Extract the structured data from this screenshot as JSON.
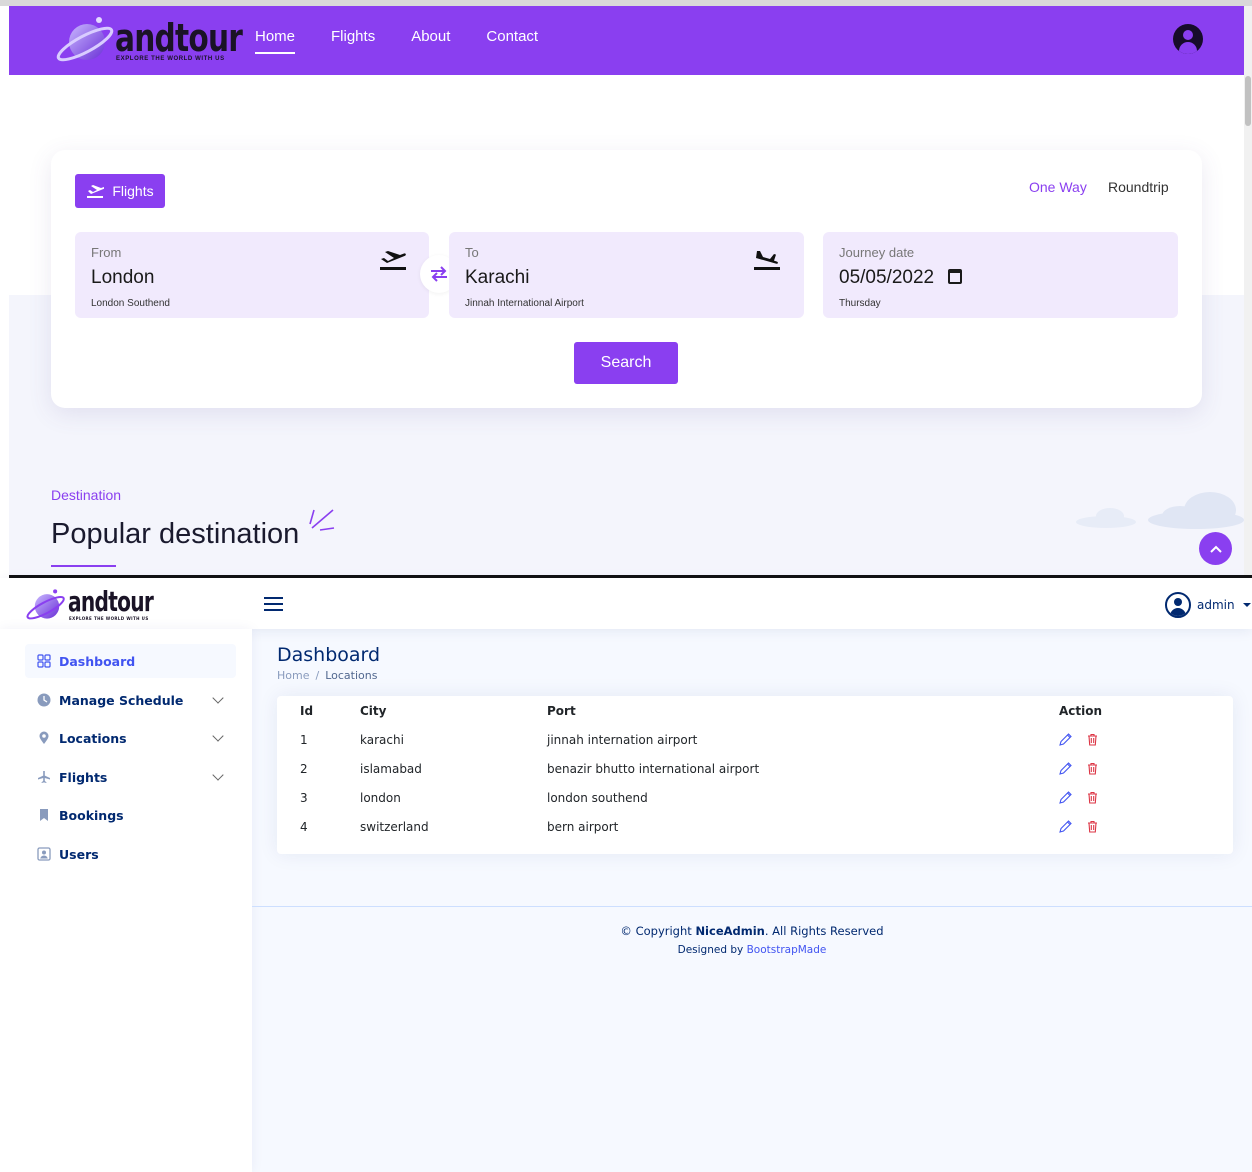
{
  "site": {
    "logo_word": "andtour",
    "logo_tagline": "EXPLORE THE WORLD WITH US",
    "nav": [
      {
        "label": "Home"
      },
      {
        "label": "Flights"
      },
      {
        "label": "About"
      },
      {
        "label": "Contact"
      }
    ],
    "search": {
      "tab_label": "Flights",
      "trip_one_way": "One Way",
      "trip_roundtrip": "Roundtrip",
      "from": {
        "label": "From",
        "value": "London",
        "sub": "London Southend"
      },
      "to": {
        "label": "To",
        "value": "Karachi",
        "sub": "Jinnah International Airport"
      },
      "date": {
        "label": "Journey date",
        "value": "05/05/2022",
        "sub": "Thursday"
      },
      "button": "Search"
    },
    "destination": {
      "label": "Destination",
      "title": "Popular destination"
    }
  },
  "admin": {
    "logo_word": "andtour",
    "logo_tagline": "EXPLORE THE WORLD WITH US",
    "user_name": "admin",
    "sidebar": [
      {
        "label": "Dashboard",
        "icon": "grid-icon",
        "active": true
      },
      {
        "label": "Manage Schedule",
        "icon": "clock-icon"
      },
      {
        "label": "Locations",
        "icon": "map-pin-icon"
      },
      {
        "label": "Flights",
        "icon": "plane-icon"
      },
      {
        "label": "Bookings",
        "icon": "bookmark-icon"
      },
      {
        "label": "Users",
        "icon": "person-badge-icon"
      }
    ],
    "page_title": "Dashboard",
    "breadcrumb": [
      "Home",
      "/",
      "Locations"
    ],
    "table": {
      "headers": [
        "Id",
        "City",
        "Port",
        "Action"
      ],
      "rows": [
        {
          "id": "1",
          "city": "karachi",
          "port": "jinnah internation airport"
        },
        {
          "id": "2",
          "city": "islamabad",
          "port": "benazir bhutto international airport"
        },
        {
          "id": "3",
          "city": "london",
          "port": "london southend"
        },
        {
          "id": "4",
          "city": "switzerland",
          "port": "bern airport"
        }
      ]
    },
    "footer": {
      "copyright_prefix": "© Copyright ",
      "copyright_brand": "NiceAdmin",
      "copyright_suffix": ". All Rights Reserved",
      "designed_prefix": "Designed by ",
      "designed_link": "BootstrapMade"
    }
  },
  "colors": {
    "brand_purple": "#8a3ff0",
    "admin_navy": "#012970",
    "admin_blue": "#4154f1",
    "delete_red": "#dc3545"
  }
}
